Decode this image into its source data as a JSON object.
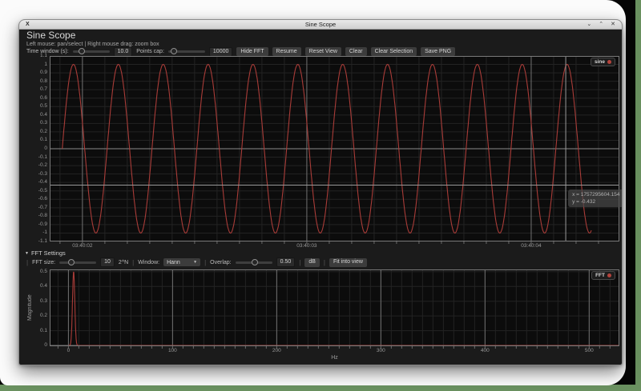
{
  "window": {
    "title": "Sine Scope",
    "icon_glyph": "X",
    "controls": {
      "minimize": "⌄",
      "maximize": "⌃",
      "close": "✕"
    }
  },
  "header": {
    "title": "Sine Scope",
    "hint": "Left mouse: pan/select | Right mouse drag: zoom box"
  },
  "toolbar": {
    "time_window": {
      "label": "Time window (s):",
      "value": "10.0",
      "handle": 0.25
    },
    "points_cap": {
      "label": "Points cap:",
      "value": "10000",
      "handle": 0.16
    },
    "buttons": [
      "Hide FFT",
      "Resume",
      "Reset View",
      "Clear",
      "Clear Selection",
      "Save PNG"
    ]
  },
  "fft_settings": {
    "collapse_icon": "▼",
    "header": "FFT Settings",
    "fft_size": {
      "label": "FFT size:",
      "value": "10",
      "suffix": "2^N",
      "handle": 0.32
    },
    "window_select": {
      "label": "Window:",
      "value": "Hann",
      "arrow": "▼"
    },
    "overlap": {
      "label": "Overlap:",
      "value": "0.50",
      "handle": 0.52
    },
    "db_button": "dB",
    "fit_button": "Fit into view"
  },
  "chart_data": [
    {
      "id": "scope",
      "type": "line",
      "legend": {
        "label": "sine",
        "position": "top-right"
      },
      "series": [
        {
          "name": "sine",
          "color": "#a93c38",
          "signal": {
            "kind": "sine",
            "frequency_hz": 5,
            "amplitude": 1,
            "t_start": 1757295601.91,
            "t_end": 1757295604.268
          }
        }
      ],
      "x_axis": {
        "kind": "time",
        "range": [
          1757295601.854,
          1757295604.393
        ],
        "minor_step": 0.1,
        "major_values": [
          1757295602,
          1757295603,
          1757295604
        ],
        "ticks": [
          {
            "value": 1757295602,
            "label": "03:40:02"
          },
          {
            "value": 1757295603,
            "label": "03:40:03"
          },
          {
            "value": 1757295604,
            "label": "03:40:04"
          }
        ]
      },
      "y_axis": {
        "range": [
          -1.1,
          1.1
        ],
        "tick_step": 0.1,
        "major_values": [
          0
        ]
      },
      "crosshair": {
        "x": 1757295604.154,
        "y": -0.432,
        "tooltip_lines": [
          "x = 1757295604.154",
          "y = -0.432"
        ]
      }
    },
    {
      "id": "fft",
      "type": "line",
      "legend": {
        "label": "FFT",
        "position": "top-right"
      },
      "ylabel": "Magnitude",
      "xlabel": "Hz",
      "series": [
        {
          "name": "FFT",
          "color": "#a93c38",
          "signal": {
            "kind": "spike",
            "center_hz": 5,
            "sigma_hz": 1.1,
            "peak": 0.5,
            "x_start": 0,
            "x_end": 529
          }
        }
      ],
      "x_axis": {
        "range": [
          -18,
          529
        ],
        "minor_step": 10,
        "major_values": [
          0,
          100,
          200,
          300,
          400,
          500
        ],
        "ticks": [
          {
            "value": 0,
            "label": "0"
          },
          {
            "value": 100,
            "label": "100"
          },
          {
            "value": 200,
            "label": "200"
          },
          {
            "value": 300,
            "label": "300"
          },
          {
            "value": 400,
            "label": "400"
          },
          {
            "value": 500,
            "label": "500"
          }
        ]
      },
      "y_axis": {
        "range": [
          -0.005,
          0.515
        ],
        "tick_step": 0.1,
        "major_values": [
          0
        ]
      }
    }
  ],
  "colors": {
    "series_red": "#a93c38",
    "plot_bg": "#0c0c0c",
    "grid_minor": "#232323",
    "grid_major": "#707070",
    "desktop_green": "#6a9160"
  }
}
